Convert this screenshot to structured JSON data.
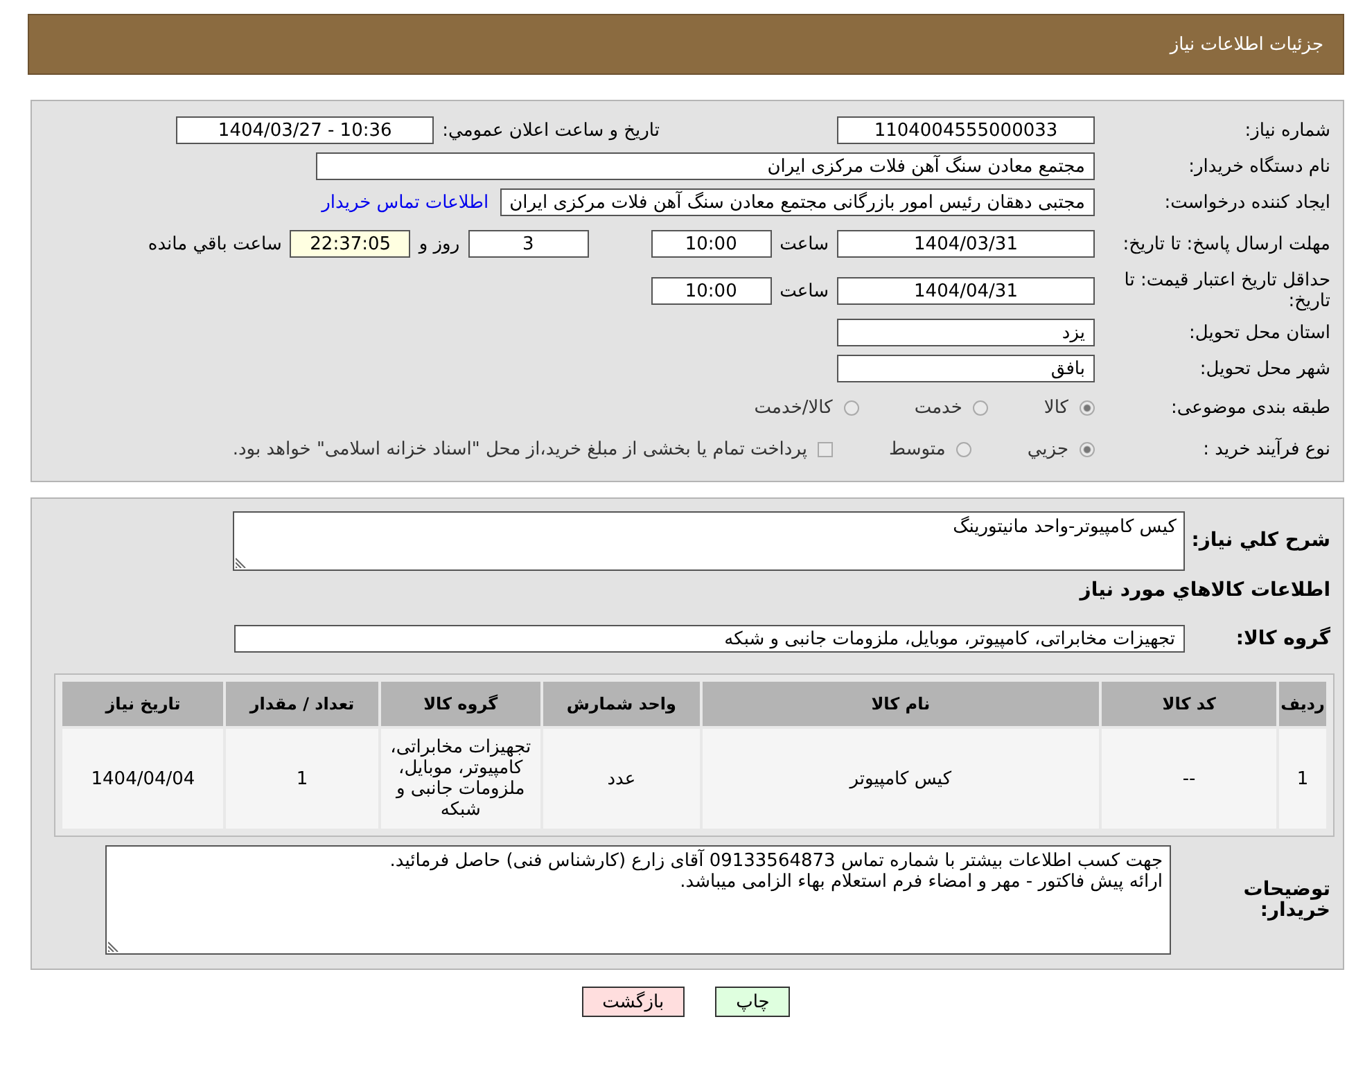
{
  "header": {
    "title": "جزئيات اطلاعات نياز"
  },
  "need_number": {
    "label": "شماره نياز:",
    "value": "1104004555000033"
  },
  "announce": {
    "label": "تاريخ و ساعت اعلان عمومي:",
    "value": "1404/03/27 - 10:36"
  },
  "buyer_org": {
    "label": "نام دستگاه خريدار:",
    "value": "مجتمع معادن سنگ آهن فلات مرکزی ایران"
  },
  "requester": {
    "label": "ايجاد کننده درخواست:",
    "value": "مجتبی  دهقان رئیس امور بازرگانی مجتمع معادن سنگ آهن فلات مرکزی ایران",
    "link": "اطلاعات تماس خريدار"
  },
  "reply_deadline": {
    "label": "مهلت ارسال پاسخ: تا تاريخ:",
    "date": "1404/03/31",
    "time_label": "ساعت",
    "time": "10:00",
    "days": "3",
    "days_label": "روز و",
    "remaining": "22:37:05",
    "remaining_label": "ساعت باقي مانده"
  },
  "price_validity": {
    "label": "حداقل تاريخ اعتبار قيمت: تا تاريخ:",
    "date": "1404/04/31",
    "time_label": "ساعت",
    "time": "10:00"
  },
  "province": {
    "label": "استان محل تحويل:",
    "value": "يزد"
  },
  "city": {
    "label": "شهر محل تحويل:",
    "value": "بافق"
  },
  "category": {
    "label": "طبقه بندی موضوعی:",
    "options": [
      {
        "kind": "radio",
        "label": "كالا",
        "selected": true
      },
      {
        "kind": "radio",
        "label": "خدمت",
        "selected": false
      },
      {
        "kind": "radio",
        "label": "كالا/خدمت",
        "selected": false
      }
    ]
  },
  "purchase_type": {
    "label": "نوع فرآيند خريد :",
    "options": [
      {
        "kind": "radio",
        "label": "جزيي",
        "selected": true
      },
      {
        "kind": "radio",
        "label": "متوسط",
        "selected": false
      },
      {
        "kind": "checkbox",
        "label": "پرداخت تمام يا بخشی از مبلغ خريد،از محل \"اسناد خزانه اسلامی\" خواهد بود.",
        "checked": false
      }
    ]
  },
  "description": {
    "label": "شرح كلي نياز:",
    "value": "کیس کامپیوتر-واحد مانیتورینگ"
  },
  "goods_heading": "اطلاعات كالاهاي مورد نياز",
  "goods_group": {
    "label": "گروه كالا:",
    "value": "تجهيزات مخابراتی، کامپيوتر، موبايل، ملزومات جانبی و شبکه"
  },
  "table": {
    "columns": [
      "رديف",
      "کد کالا",
      "نام کالا",
      "واحد شمارش",
      "گروه کالا",
      "تعداد / مقدار",
      "تاريخ نياز"
    ],
    "rows": [
      [
        "1",
        "--",
        "کیس کامپیوتر",
        "عدد",
        "تجهيزات مخابراتی، کامپيوتر، موبايل، ملزومات جانبی و شبکه",
        "1",
        "1404/04/04"
      ]
    ]
  },
  "buyer_notes": {
    "label": "توضيحات خريدار:",
    "lines": [
      "جهت کسب اطلاعات بیشتر با شماره تماس 09133564873 آقای زارع (کارشناس فنی) حاصل فرمائید.",
      "ارائه پیش فاکتور - مهر و امضاء فرم استعلام بهاء الزامی میباشد."
    ]
  },
  "buttons": [
    {
      "kind": "print",
      "label": "چاپ"
    },
    {
      "kind": "back",
      "label": "بازگشت"
    }
  ]
}
